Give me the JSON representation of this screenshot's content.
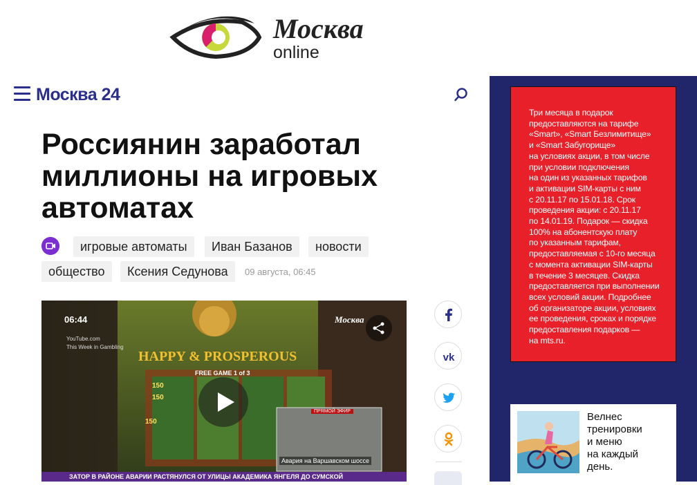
{
  "brand": {
    "title": "Москва",
    "subtitle": "online"
  },
  "nav": {
    "logo": "Москва 24"
  },
  "article": {
    "headline": "Россиянин заработал миллионы на игровых автоматах",
    "tags": [
      "игровые автоматы",
      "Иван Базанов",
      "новости",
      "общество",
      "Ксения Седунова"
    ],
    "date": "09 августа, 06:45"
  },
  "video": {
    "time": "06:44",
    "source_line1": "YouTube.com",
    "source_line2": "This Week in Gambling",
    "watermark": "Москва",
    "game_title": "HAPPY & PROSPEROUS",
    "free_game": "FREE GAME",
    "free_game_count": "1 of 3",
    "live_label": "ПРЯМОЙ ЭФИР",
    "inset_caption": "Авария на Варшавском шоссе",
    "ticker": "ЗАТОР В РАЙОНЕ АВАРИИ РАСТЯНУЛСЯ ОТ УЛИЦЫ АКАДЕМИКА ЯНГЕЛЯ ДО СУМСКОЙ",
    "reel_values": [
      "150",
      "150",
      "150"
    ]
  },
  "share": [
    "facebook-icon",
    "vk-icon",
    "twitter-icon",
    "odnoklassniki-icon"
  ],
  "sidebar": {
    "promo_lines": [
      "Три месяца в подарок",
      "предоставляются на тарифе",
      "«Smart», «Smart Безлимитище»",
      "и «Smart Забугорище»",
      "на условиях акции, в том числе",
      "при условии подключения",
      "на один из указанных тарифов",
      "и активации SIM-карты с ним",
      "с 20.11.17 по 15.01.18. Срок",
      "проведения акции: с 20.11.17",
      "по 14.01.19. Подарок — скидка",
      "100% на абонентскую плату",
      "по указанным тарифам,",
      "предоставляемая с 10-го месяца",
      "с момента активации SIM-карты",
      "в течение 3 месяцев. Скидка",
      "предоставляется при выполнении",
      "всех условий акции. Подробнее",
      "об организаторе акции, условиях",
      "ее проведения, сроках и порядке",
      "предоставления подарков —",
      "на mts.ru."
    ],
    "wellness_lines": [
      "Велнес",
      "тренировки",
      "и меню",
      "на каждый",
      "день."
    ]
  },
  "colors": {
    "brand_blue": "#2a2f8c",
    "sidebar_bg": "#21256a",
    "promo_red": "#e8202a",
    "video_badge": "#7b2fd0"
  }
}
